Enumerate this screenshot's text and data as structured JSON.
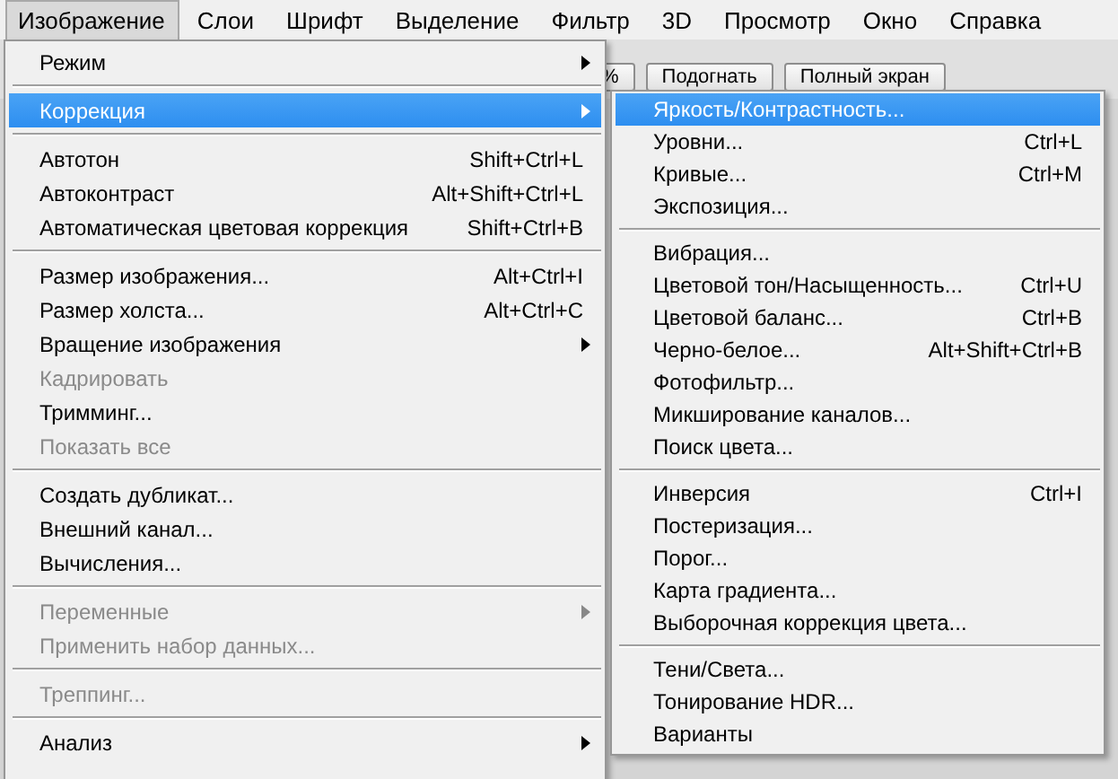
{
  "menubar": [
    {
      "label": "Изображение",
      "selected": true
    },
    {
      "label": "Слои",
      "selected": false
    },
    {
      "label": "Шрифт",
      "selected": false
    },
    {
      "label": "Выделение",
      "selected": false
    },
    {
      "label": "Фильтр",
      "selected": false
    },
    {
      "label": "3D",
      "selected": false
    },
    {
      "label": "Просмотр",
      "selected": false
    },
    {
      "label": "Окно",
      "selected": false
    },
    {
      "label": "Справка",
      "selected": false
    }
  ],
  "toolbar_buttons": [
    "%",
    "Подогнать",
    "Полный экран"
  ],
  "menu": {
    "items": [
      {
        "kind": "item",
        "label": "Режим",
        "submenu": true,
        "disabled": false,
        "selected": false
      },
      {
        "kind": "separator"
      },
      {
        "kind": "item",
        "label": "Коррекция",
        "submenu": true,
        "disabled": false,
        "selected": true
      },
      {
        "kind": "separator"
      },
      {
        "kind": "item",
        "label": "Автотон",
        "shortcut": "Shift+Ctrl+L",
        "submenu": false,
        "disabled": false,
        "selected": false
      },
      {
        "kind": "item",
        "label": "Автоконтраст",
        "shortcut": "Alt+Shift+Ctrl+L",
        "submenu": false,
        "disabled": false,
        "selected": false
      },
      {
        "kind": "item",
        "label": "Автоматическая цветовая коррекция",
        "shortcut": "Shift+Ctrl+B",
        "submenu": false,
        "disabled": false,
        "selected": false
      },
      {
        "kind": "separator"
      },
      {
        "kind": "item",
        "label": "Размер изображения...",
        "shortcut": "Alt+Ctrl+I",
        "submenu": false,
        "disabled": false,
        "selected": false
      },
      {
        "kind": "item",
        "label": "Размер холста...",
        "shortcut": "Alt+Ctrl+C",
        "submenu": false,
        "disabled": false,
        "selected": false
      },
      {
        "kind": "item",
        "label": "Вращение изображения",
        "submenu": true,
        "disabled": false,
        "selected": false
      },
      {
        "kind": "item",
        "label": "Кадрировать",
        "submenu": false,
        "disabled": true,
        "selected": false
      },
      {
        "kind": "item",
        "label": "Тримминг...",
        "submenu": false,
        "disabled": false,
        "selected": false
      },
      {
        "kind": "item",
        "label": "Показать все",
        "submenu": false,
        "disabled": true,
        "selected": false
      },
      {
        "kind": "separator"
      },
      {
        "kind": "item",
        "label": "Создать дубликат...",
        "submenu": false,
        "disabled": false,
        "selected": false
      },
      {
        "kind": "item",
        "label": "Внешний канал...",
        "submenu": false,
        "disabled": false,
        "selected": false
      },
      {
        "kind": "item",
        "label": "Вычисления...",
        "submenu": false,
        "disabled": false,
        "selected": false
      },
      {
        "kind": "separator"
      },
      {
        "kind": "item",
        "label": "Переменные",
        "submenu": true,
        "disabled": true,
        "selected": false
      },
      {
        "kind": "item",
        "label": "Применить набор данных...",
        "submenu": false,
        "disabled": true,
        "selected": false
      },
      {
        "kind": "separator"
      },
      {
        "kind": "item",
        "label": "Треппинг...",
        "submenu": false,
        "disabled": true,
        "selected": false
      },
      {
        "kind": "separator"
      },
      {
        "kind": "item",
        "label": "Анализ",
        "submenu": true,
        "disabled": false,
        "selected": false
      }
    ]
  },
  "submenu": {
    "items": [
      {
        "kind": "item",
        "label": "Яркость/Контрастность...",
        "selected": true
      },
      {
        "kind": "item",
        "label": "Уровни...",
        "shortcut": "Ctrl+L",
        "selected": false
      },
      {
        "kind": "item",
        "label": "Кривые...",
        "shortcut": "Ctrl+M",
        "selected": false
      },
      {
        "kind": "item",
        "label": "Экспозиция...",
        "selected": false
      },
      {
        "kind": "separator"
      },
      {
        "kind": "item",
        "label": "Вибрация...",
        "selected": false
      },
      {
        "kind": "item",
        "label": "Цветовой тон/Насыщенность...",
        "shortcut": "Ctrl+U",
        "selected": false
      },
      {
        "kind": "item",
        "label": "Цветовой баланс...",
        "shortcut": "Ctrl+B",
        "selected": false
      },
      {
        "kind": "item",
        "label": "Черно-белое...",
        "shortcut": "Alt+Shift+Ctrl+B",
        "selected": false
      },
      {
        "kind": "item",
        "label": "Фотофильтр...",
        "selected": false
      },
      {
        "kind": "item",
        "label": "Микширование каналов...",
        "selected": false
      },
      {
        "kind": "item",
        "label": "Поиск цвета...",
        "selected": false
      },
      {
        "kind": "separator"
      },
      {
        "kind": "item",
        "label": "Инверсия",
        "shortcut": "Ctrl+I",
        "selected": false
      },
      {
        "kind": "item",
        "label": "Постеризация...",
        "selected": false
      },
      {
        "kind": "item",
        "label": "Порог...",
        "selected": false
      },
      {
        "kind": "item",
        "label": "Карта градиента...",
        "selected": false
      },
      {
        "kind": "item",
        "label": "Выборочная коррекция цвета...",
        "selected": false
      },
      {
        "kind": "separator"
      },
      {
        "kind": "item",
        "label": "Тени/Света...",
        "selected": false
      },
      {
        "kind": "item",
        "label": "Тонирование HDR...",
        "selected": false
      },
      {
        "kind": "item",
        "label": "Варианты",
        "selected": false
      }
    ]
  }
}
